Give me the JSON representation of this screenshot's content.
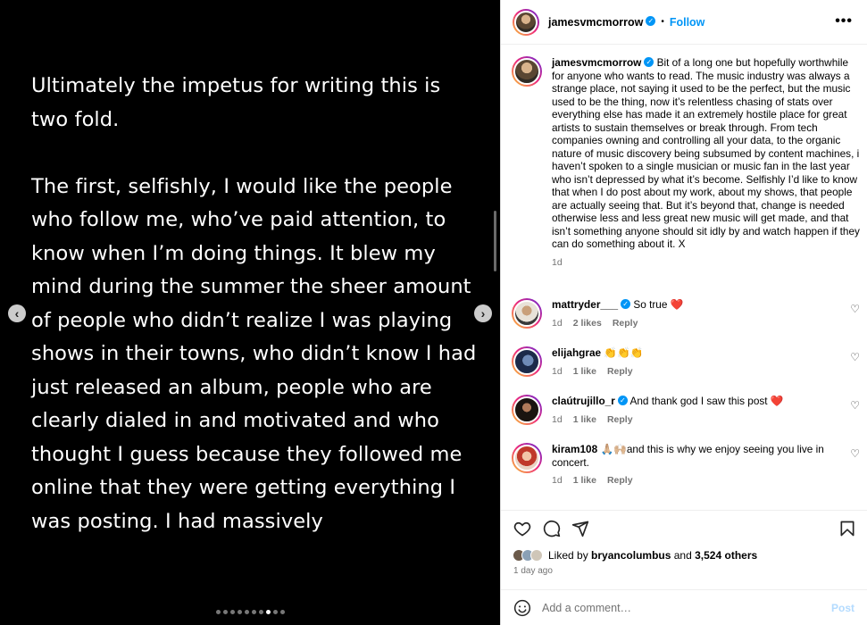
{
  "media": {
    "paragraphs": [
      "Ultimately the impetus for writing this is two fold.",
      "The first, selfishly, I would like the people who follow me, who’ve paid attention, to know when I’m doing things. It blew my mind during the summer the sheer amount of people who didn’t realize I was playing shows in their towns, who didn’t know I had just released an album, people who are clearly dialed in and motivated and who thought I guess because they followed me online that they were getting everything I was posting. I had massively"
    ],
    "prev_icon": "chevron-left-icon",
    "next_icon": "chevron-right-icon",
    "slide_count": 10,
    "active_slide": 8
  },
  "header": {
    "username": "jamesvmcmorrow",
    "separator": "•",
    "follow_label": "Follow",
    "more_label": "•••"
  },
  "caption": {
    "username": "jamesvmcmorrow",
    "text": "Bit of a long one but hopefully worthwhile for anyone who wants to read. The music industry was always a strange place, not saying it used to be the perfect, but the music used to be the thing, now it’s relentless chasing of stats over everything else has made it an extremely hostile place for great artists to sustain themselves or break through. From tech companies owning and controlling all your data, to the organic nature of music discovery being subsumed by content machines, i haven’t spoken to a single musician or music fan in the last year who isn’t depressed by what it’s become. Selfishly I’d like to know that when I do post about my work, about my shows, that people are actually seeing that. But it’s beyond that, change is needed otherwise less and less great new music will get made, and that isn’t something anyone should sit idly by and watch happen if they can do something about it. X",
    "time": "1d"
  },
  "comments": [
    {
      "username": "mattryder___",
      "verified": true,
      "text": "So true ❤️",
      "time": "1d",
      "likes": "2 likes",
      "reply": "Reply"
    },
    {
      "username": "elijahgrae",
      "verified": false,
      "text": "👏👏👏",
      "time": "1d",
      "likes": "1 like",
      "reply": "Reply"
    },
    {
      "username": "claútrujillo_r",
      "verified": true,
      "text": "And thank god I saw this post ❤️",
      "time": "1d",
      "likes": "1 like",
      "reply": "Reply"
    },
    {
      "username": "kiram108",
      "verified": false,
      "text": "🙏🏼🙌🏼and this is why we enjoy seeing you live in concert.",
      "time": "1d",
      "likes": "1 like",
      "reply": "Reply"
    }
  ],
  "actions": {
    "like_icon": "heart-icon",
    "comment_icon": "comment-icon",
    "share_icon": "share-icon",
    "save_icon": "bookmark-icon"
  },
  "likes": {
    "prefix": "Liked by",
    "user": "bryancolumbus",
    "middle": "and",
    "others": "3,524 others"
  },
  "time_ago": "1 day ago",
  "comment_box": {
    "placeholder": "Add a comment…",
    "post_label": "Post",
    "emoji_icon": "smiley-icon"
  },
  "colors": {
    "accent": "#0095f6",
    "verified": "#0095f6",
    "muted": "#737373"
  }
}
